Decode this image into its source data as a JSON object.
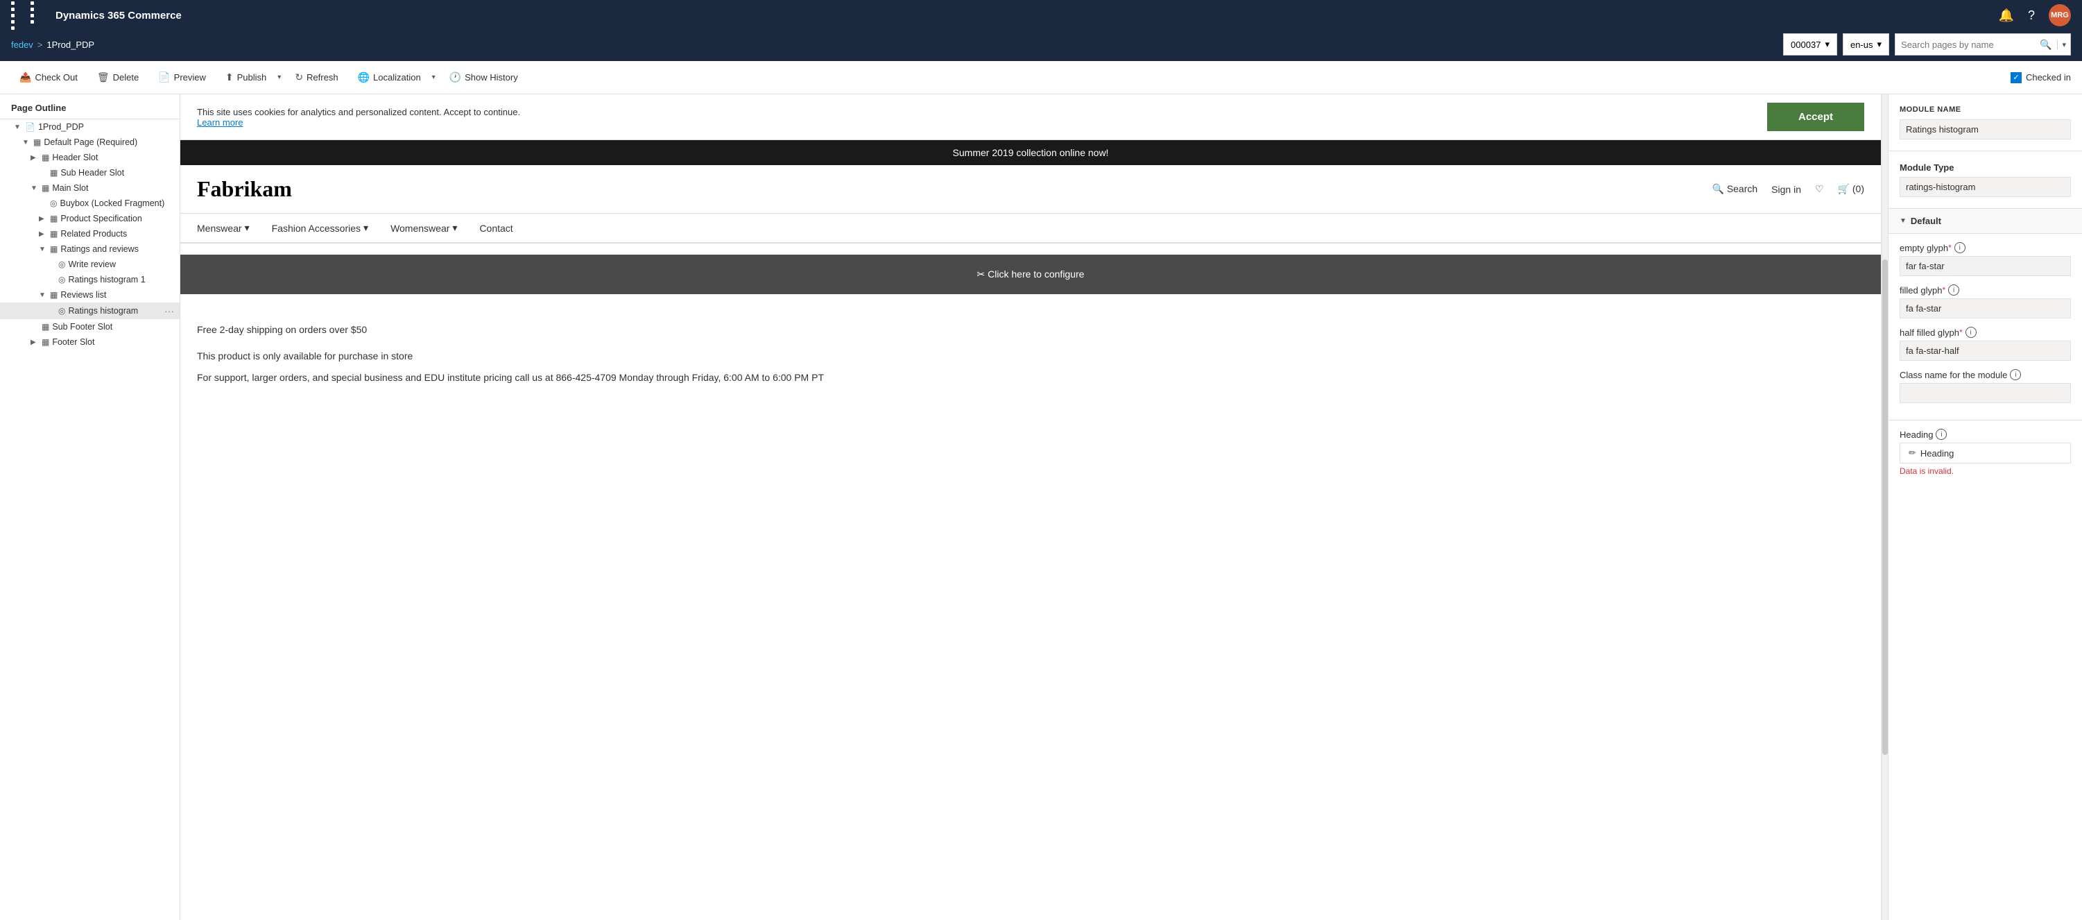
{
  "topBar": {
    "title": "Dynamics 365 Commerce",
    "avatarLabel": "MRG",
    "avatarBg": "#d55c35"
  },
  "breadcrumb": {
    "link": "fedev",
    "separator": ">",
    "current": "1Prod_PDP"
  },
  "dropdowns": {
    "storeId": "000037",
    "locale": "en-us"
  },
  "search": {
    "placeholder": "Search pages by name"
  },
  "toolbar": {
    "checkOut": "Check Out",
    "delete": "Delete",
    "preview": "Preview",
    "publish": "Publish",
    "refresh": "Refresh",
    "localization": "Localization",
    "showHistory": "Show History",
    "checkedIn": "Checked in"
  },
  "sidebar": {
    "title": "Page Outline",
    "items": [
      {
        "id": "1prod-pdp",
        "label": "1Prod_PDP",
        "indent": 1,
        "toggle": "▼",
        "icon": "📄",
        "type": "page"
      },
      {
        "id": "default-page",
        "label": "Default Page (Required)",
        "indent": 2,
        "toggle": "▼",
        "icon": "📋",
        "type": "container"
      },
      {
        "id": "header-slot",
        "label": "Header Slot",
        "indent": 3,
        "toggle": "▶",
        "icon": "▦",
        "type": "slot"
      },
      {
        "id": "sub-header-slot",
        "label": "Sub Header Slot",
        "indent": 4,
        "toggle": "",
        "icon": "▦",
        "type": "slot"
      },
      {
        "id": "main-slot",
        "label": "Main Slot",
        "indent": 3,
        "toggle": "▼",
        "icon": "▦",
        "type": "slot"
      },
      {
        "id": "buybox",
        "label": "Buybox (Locked Fragment)",
        "indent": 4,
        "toggle": "",
        "icon": "◎",
        "type": "fragment"
      },
      {
        "id": "product-specification",
        "label": "Product Specification",
        "indent": 4,
        "toggle": "▶",
        "icon": "▦",
        "type": "slot"
      },
      {
        "id": "related-products",
        "label": "Related Products",
        "indent": 4,
        "toggle": "▶",
        "icon": "▦",
        "type": "slot"
      },
      {
        "id": "ratings-reviews",
        "label": "Ratings and reviews",
        "indent": 4,
        "toggle": "▼",
        "icon": "▦",
        "type": "slot"
      },
      {
        "id": "write-review",
        "label": "Write review",
        "indent": 5,
        "toggle": "",
        "icon": "◎",
        "type": "module"
      },
      {
        "id": "ratings-histogram-1",
        "label": "Ratings histogram 1",
        "indent": 5,
        "toggle": "",
        "icon": "◎",
        "type": "module"
      },
      {
        "id": "reviews-list",
        "label": "Reviews list",
        "indent": 4,
        "toggle": "▼",
        "icon": "▦",
        "type": "slot"
      },
      {
        "id": "ratings-histogram",
        "label": "Ratings histogram",
        "indent": 5,
        "toggle": "",
        "icon": "◎",
        "type": "module",
        "selected": true
      },
      {
        "id": "sub-footer-slot",
        "label": "Sub Footer Slot",
        "indent": 3,
        "toggle": "",
        "icon": "▦",
        "type": "slot"
      },
      {
        "id": "footer-slot",
        "label": "Footer Slot",
        "indent": 3,
        "toggle": "▶",
        "icon": "▦",
        "type": "slot"
      }
    ]
  },
  "canvas": {
    "cookieBanner": {
      "text": "This site uses cookies for analytics and personalized content. Accept to continue.",
      "linkText": "Learn more",
      "acceptBtn": "Accept"
    },
    "summerBanner": "Summer 2019 collection online now!",
    "storeLogo": "Fabrikam",
    "storeNav": {
      "search": "Search",
      "signIn": "Sign in",
      "cart": "(0)",
      "items": [
        "Menswear",
        "Fashion Accessories",
        "Womenswear",
        "Contact"
      ]
    },
    "configurePlaceholder": "Click here to configure",
    "shippingText": "Free 2-day shipping on orders over $50",
    "productAvailability": "This product is only available for purchase in store",
    "supportText": "For support, larger orders, and special business and EDU institute pricing call us at 866-425-4709 Monday through Friday, 6:00 AM to 6:00 PM PT"
  },
  "rightPanel": {
    "moduleName": {
      "label": "MODULE NAME",
      "value": "Ratings histogram"
    },
    "moduleType": {
      "label": "Module Type",
      "value": "ratings-histogram"
    },
    "defaultSection": {
      "label": "Default",
      "fields": [
        {
          "id": "empty-glyph",
          "label": "empty glyph",
          "required": true,
          "hasInfo": true,
          "value": "far fa-star"
        },
        {
          "id": "filled-glyph",
          "label": "filled glyph",
          "required": true,
          "hasInfo": true,
          "value": "fa fa-star"
        },
        {
          "id": "half-filled-glyph",
          "label": "half filled glyph",
          "required": true,
          "hasInfo": true,
          "value": "fa fa-star-half"
        },
        {
          "id": "class-name",
          "label": "Class name for the module",
          "required": false,
          "hasInfo": true,
          "value": ""
        }
      ]
    },
    "headingSection": {
      "label": "Heading",
      "hasInfo": true,
      "btnLabel": "Heading",
      "errorText": "Data is invalid."
    }
  }
}
